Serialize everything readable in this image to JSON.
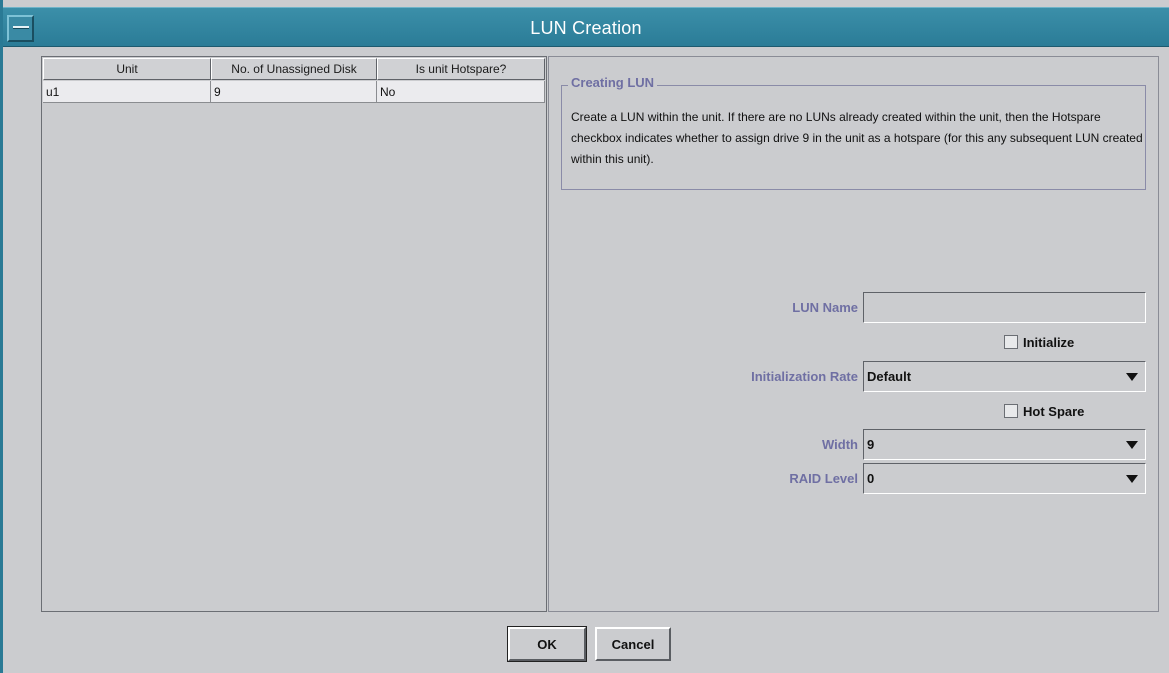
{
  "window": {
    "title": "LUN Creation"
  },
  "table": {
    "headers": [
      "Unit",
      "No. of Unassigned Disk",
      "Is unit Hotspare?"
    ],
    "rows": [
      {
        "unit": "u1",
        "unassigned": "9",
        "hotspare": "No"
      }
    ]
  },
  "group": {
    "title": "Creating LUN",
    "description": "Create a LUN within the unit.  If there are no LUNs already created within the unit, then the Hotspare checkbox indicates whether to assign drive 9 in the unit as a hotspare (for this any subsequent LUN created within this unit)."
  },
  "form": {
    "lun_name_label": "LUN Name",
    "lun_name_value": "",
    "initialize_label": "Initialize",
    "init_rate_label": "Initialization Rate",
    "init_rate_value": "Default",
    "hot_spare_label": "Hot Spare",
    "width_label": "Width",
    "width_value": "9",
    "raid_label": "RAID Level",
    "raid_value": "0"
  },
  "buttons": {
    "ok": "OK",
    "cancel": "Cancel"
  },
  "colors": {
    "titlebar": "#2b7c97",
    "label": "#6f6fa3",
    "background": "#cbcccf"
  }
}
